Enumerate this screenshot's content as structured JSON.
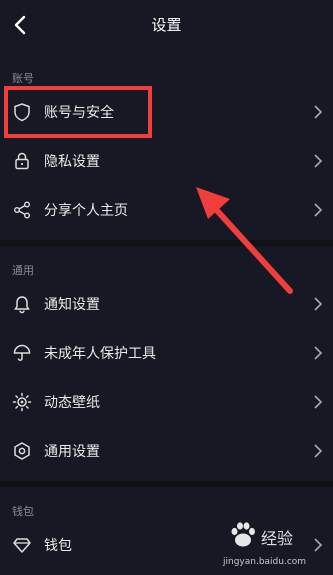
{
  "header": {
    "title": "设置"
  },
  "sections": [
    {
      "label": "账号"
    },
    {
      "label": "通用"
    },
    {
      "label": "钱包"
    }
  ],
  "items": [
    {
      "label": "账号与安全",
      "icon": "shield-icon"
    },
    {
      "label": "隐私设置",
      "icon": "lock-icon"
    },
    {
      "label": "分享个人主页",
      "icon": "share-icon"
    },
    {
      "label": "通知设置",
      "icon": "bell-icon"
    },
    {
      "label": "未成年人保护工具",
      "icon": "umbrella-icon"
    },
    {
      "label": "动态壁纸",
      "icon": "wallpaper-icon"
    },
    {
      "label": "通用设置",
      "icon": "hexagon-icon"
    },
    {
      "label": "钱包",
      "icon": "diamond-icon"
    }
  ],
  "watermark": {
    "text": "经验",
    "url": "jingyan.baidu.com"
  },
  "colors": {
    "background": "#161823",
    "highlight": "#ef3e3b",
    "text": "#eaeaea",
    "section": "#8a8b91"
  }
}
